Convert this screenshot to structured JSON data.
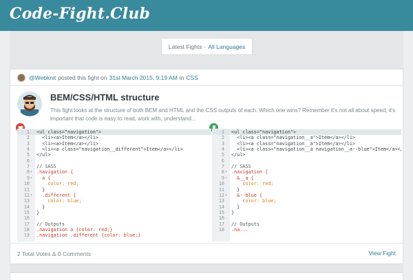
{
  "header": {
    "logo": "Code-Fight.Club"
  },
  "filter": {
    "label": "Latest Fights",
    "separator": "·",
    "link": "All Languages"
  },
  "fight": {
    "author": "@Webknit",
    "posted_text": "posted this fight on",
    "date": "31st March 2015, 9:19 AM",
    "in_text": "in",
    "language": "CSS",
    "title": "BEM/CSS/HTML structure",
    "description": "This fight looks at the structure of both BEM and HTML and the CSS outputs of each. Which one wins? Remember it's not all about speed, it's important that code is easy to read, work with, understand...",
    "votes_text": "2 Total Votes & 0 Comments",
    "view_label": "View Fight"
  },
  "left_code": [
    {
      "n": "1",
      "t": "<ul class=\"navigation\">",
      "c": "",
      "f": ""
    },
    {
      "n": "2",
      "t": "  <li><a>Item</a></li>",
      "c": "",
      "f": ""
    },
    {
      "n": "3",
      "t": "  <li><a>Item</a></li>",
      "c": "",
      "f": ""
    },
    {
      "n": "4",
      "t": "  <li><a class=\"navigation__different\">Item</a></li>",
      "c": "",
      "f": ""
    },
    {
      "n": "5",
      "t": "</ul>",
      "c": "",
      "f": ""
    },
    {
      "n": "6",
      "t": "",
      "c": "",
      "f": ""
    },
    {
      "n": "7",
      "t": "// SASS",
      "c": "c-comment",
      "f": ""
    },
    {
      "n": "8",
      "t": ".navigation {",
      "c": "c-sel",
      "f": "▾"
    },
    {
      "n": "9",
      "t": "  a {",
      "c": "c-sel",
      "f": "▾"
    },
    {
      "n": "10",
      "t": "    color: red;",
      "c": "c-prop",
      "f": ""
    },
    {
      "n": "11",
      "t": "  }",
      "c": "",
      "f": ""
    },
    {
      "n": "12",
      "t": "  .different {",
      "c": "c-sel",
      "f": "▾"
    },
    {
      "n": "13",
      "t": "    color: blue;",
      "c": "c-prop",
      "f": ""
    },
    {
      "n": "14",
      "t": "  }",
      "c": "",
      "f": ""
    },
    {
      "n": "15",
      "t": "}",
      "c": "",
      "f": ""
    },
    {
      "n": "16",
      "t": "",
      "c": "",
      "f": ""
    },
    {
      "n": "17",
      "t": "// Outputs",
      "c": "c-comment",
      "f": ""
    },
    {
      "n": "18",
      "t": ".navigation a {color: red;}",
      "c": "c-sel",
      "f": ""
    },
    {
      "n": "19",
      "t": ".navigation .different {color: blue;}",
      "c": "c-sel",
      "f": ""
    }
  ],
  "right_code": [
    {
      "n": "1",
      "t": "<ul class=\"navigation\">",
      "c": "",
      "f": ""
    },
    {
      "n": "2",
      "t": "  <li><a class=\"navigation__a\">Item</a></li>",
      "c": "",
      "f": ""
    },
    {
      "n": "3",
      "t": "  <li><a class=\"navigation__a\">Item</a></li>",
      "c": "",
      "f": ""
    },
    {
      "n": "4",
      "t": "  <li><a class=\"navigation__a navigation__a--blue\">Item</a></li>",
      "c": "",
      "f": ""
    },
    {
      "n": "5",
      "t": "</ul>",
      "c": "",
      "f": ""
    },
    {
      "n": "6",
      "t": "",
      "c": "",
      "f": ""
    },
    {
      "n": "7",
      "t": "// SASS",
      "c": "c-comment",
      "f": ""
    },
    {
      "n": "8",
      "t": ".navigation {",
      "c": "c-sel",
      "f": "▾"
    },
    {
      "n": "9",
      "t": "  &__a {",
      "c": "c-sel",
      "f": "▾"
    },
    {
      "n": "10",
      "t": "    color: red;",
      "c": "c-prop",
      "f": ""
    },
    {
      "n": "11",
      "t": "  }",
      "c": "",
      "f": ""
    },
    {
      "n": "12",
      "t": "  &--blue {",
      "c": "c-sel",
      "f": "▾"
    },
    {
      "n": "13",
      "t": "    color: blue;",
      "c": "c-prop",
      "f": ""
    },
    {
      "n": "14",
      "t": "  }",
      "c": "",
      "f": ""
    },
    {
      "n": "15",
      "t": "}",
      "c": "",
      "f": ""
    },
    {
      "n": "16",
      "t": "",
      "c": "",
      "f": ""
    },
    {
      "n": "17",
      "t": "// Outputs",
      "c": "c-comment",
      "f": ""
    },
    {
      "n": "18",
      "t": ".na...",
      "c": "c-sel",
      "f": ""
    }
  ],
  "colors": {
    "header": "#3a8a9d",
    "link": "#2f7f98",
    "loser_badge": "#d0443a",
    "winner_badge": "#3aa65a"
  },
  "icons": {
    "left_badge": "heart-broken-icon",
    "right_badge": "trophy-icon"
  }
}
